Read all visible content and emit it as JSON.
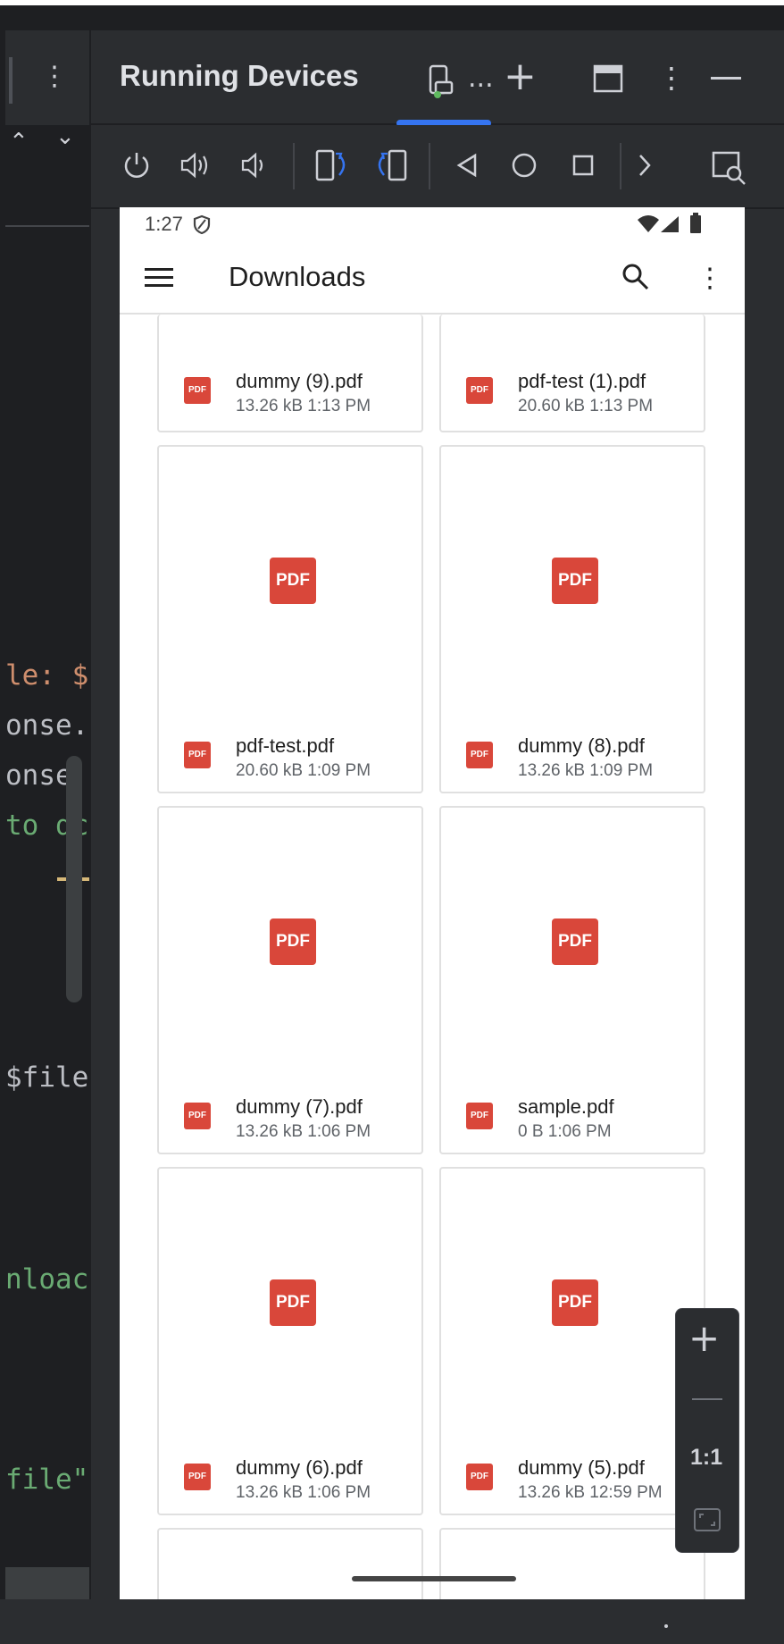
{
  "panel": {
    "title": "Running Devices",
    "more_tabs": "..."
  },
  "editor": {
    "lines": [
      {
        "text": "le: ${",
        "color": "#cf8e6d"
      },
      {
        "text": "onse.c",
        "color": "#bcbec4"
      },
      {
        "text": "onse.b",
        "color": "#bcbec4"
      },
      {
        "text": "to dc",
        "color": "#6aab73"
      },
      {
        "text": "$fileM",
        "color": "#bcbec4"
      },
      {
        "text": "nloac",
        "color": "#6aab73"
      },
      {
        "text": "file\"",
        "color": "#6aab73"
      }
    ]
  },
  "status": {
    "time": "1:27"
  },
  "appbar": {
    "title": "Downloads"
  },
  "files": [
    {
      "name": "dummy (9).pdf",
      "meta": "13.26 kB 1:13 PM"
    },
    {
      "name": "pdf-test (1).pdf",
      "meta": "20.60 kB 1:13 PM"
    },
    {
      "name": "pdf-test.pdf",
      "meta": "20.60 kB 1:09 PM"
    },
    {
      "name": "dummy (8).pdf",
      "meta": "13.26 kB 1:09 PM"
    },
    {
      "name": "dummy (7).pdf",
      "meta": "13.26 kB 1:06 PM"
    },
    {
      "name": "sample.pdf",
      "meta": "0 B 1:06 PM"
    },
    {
      "name": "dummy (6).pdf",
      "meta": "13.26 kB 1:06 PM"
    },
    {
      "name": "dummy (5).pdf",
      "meta": "13.26 kB 12:59 PM"
    }
  ],
  "pdf_label": "PDF",
  "zoom": {
    "ratio_label": "1:1"
  },
  "colors": {
    "accent": "#3574f0",
    "pdf_red": "#d9473a"
  }
}
